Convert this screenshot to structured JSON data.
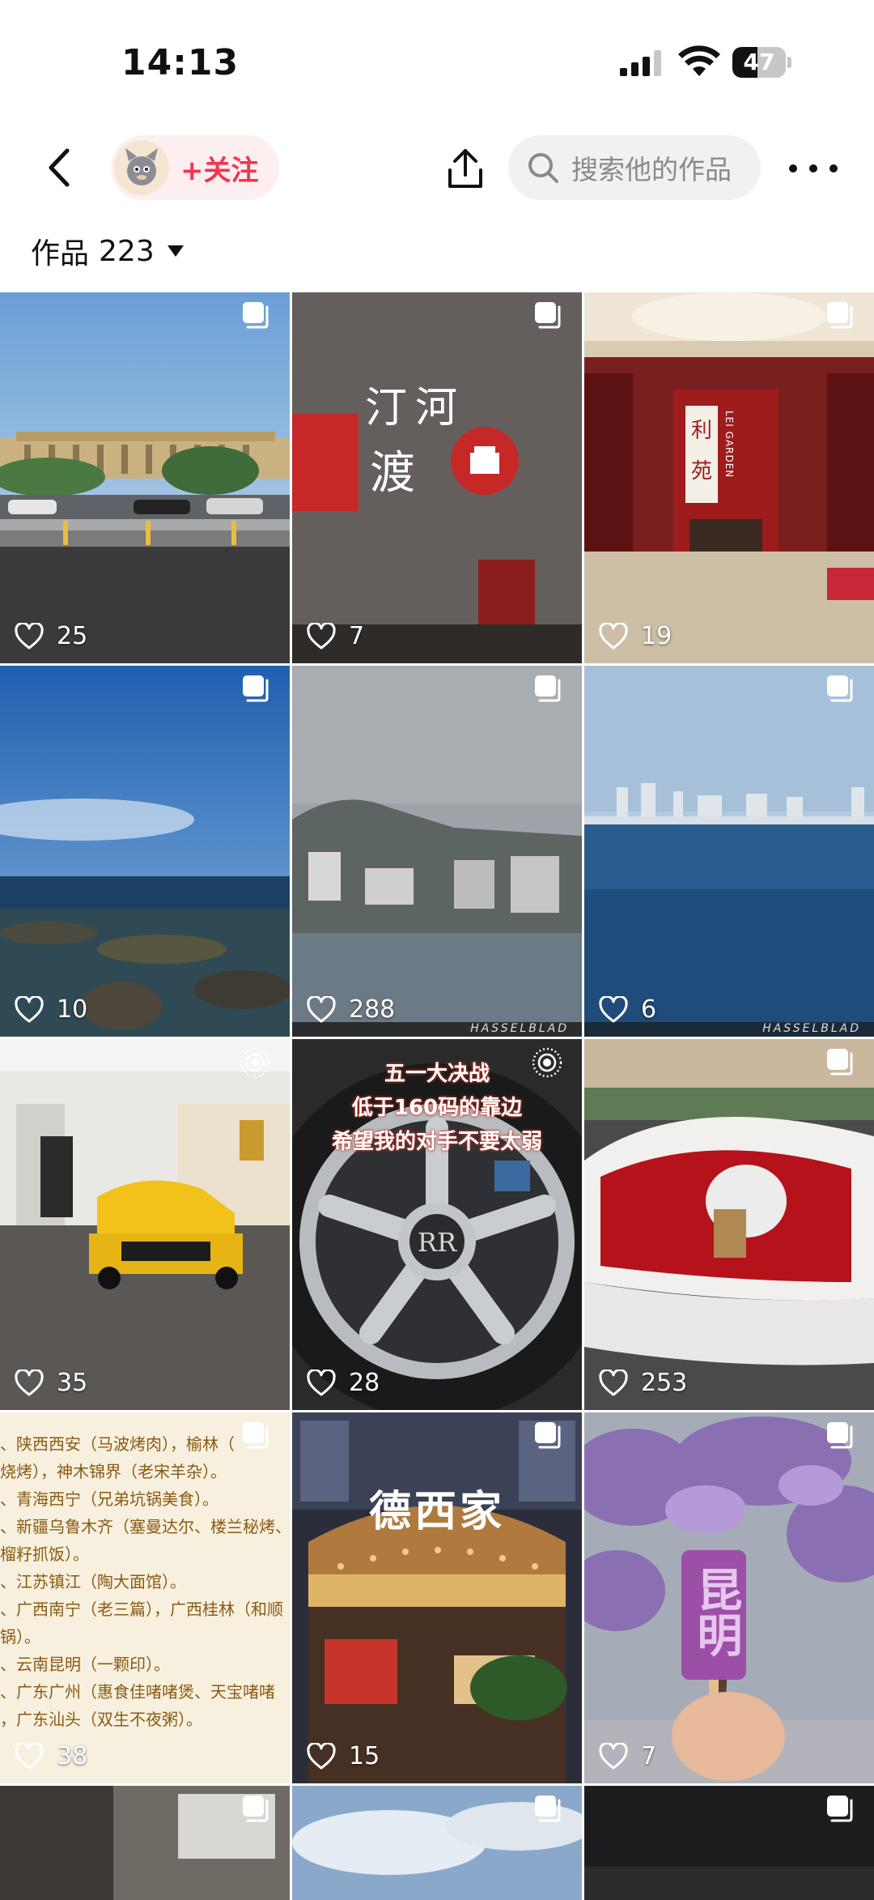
{
  "status_bar": {
    "time": "14:13",
    "battery": "47",
    "battery_level": 0.47
  },
  "nav": {
    "follow_label": "+关注",
    "search_placeholder": "搜索他的作品"
  },
  "works": {
    "label": "作品",
    "count": "223"
  },
  "tiles": [
    {
      "likes": "25",
      "badge": "multi"
    },
    {
      "likes": "7",
      "badge": "multi",
      "overlay": [
        "汀河",
        "渡"
      ]
    },
    {
      "likes": "19",
      "badge": "multi",
      "overlay": [
        "利",
        "苑",
        "LEI GARDEN"
      ]
    },
    {
      "likes": "10",
      "badge": "multi"
    },
    {
      "likes": "288",
      "badge": "multi",
      "footer": "HASSELBLAD"
    },
    {
      "likes": "6",
      "badge": "multi",
      "footer": "HASSELBLAD"
    },
    {
      "likes": "35",
      "badge": "live"
    },
    {
      "likes": "28",
      "badge": "live",
      "overlay": [
        "五一大决战",
        "低于160码的靠边",
        "希望我的对手不要太弱"
      ]
    },
    {
      "likes": "253",
      "badge": "multi"
    },
    {
      "likes": "38",
      "badge": "multi",
      "overlay": [
        "、陕西西安（马波烤肉），榆林（",
        "烧烤），神木锦界（老宋羊杂）。",
        "、青海西宁（兄弟坑锅美食）。",
        "、新疆乌鲁木齐（塞曼达尔、楼兰秘烤、",
        "榴籽抓饭）。",
        "、江苏镇江（陶大面馆）。",
        "、广西南宁（老三篇），广西桂林（和顺",
        "锅）。",
        "、云南昆明（一颗印）。",
        "、广东广州（惠食佳啫啫煲、天宝啫啫",
        "，广东汕头（双生不夜粥）。"
      ]
    },
    {
      "likes": "15",
      "badge": "multi",
      "overlay": [
        "德西家"
      ]
    },
    {
      "likes": "7",
      "badge": "multi",
      "overlay": [
        "昆明"
      ]
    },
    {
      "badge": "multi"
    },
    {
      "badge": "multi"
    },
    {
      "badge": "multi"
    }
  ],
  "colors": {
    "accent": "#f0374f",
    "follow_bg": "#fdeef0",
    "search_bg": "#f1f1f3"
  }
}
